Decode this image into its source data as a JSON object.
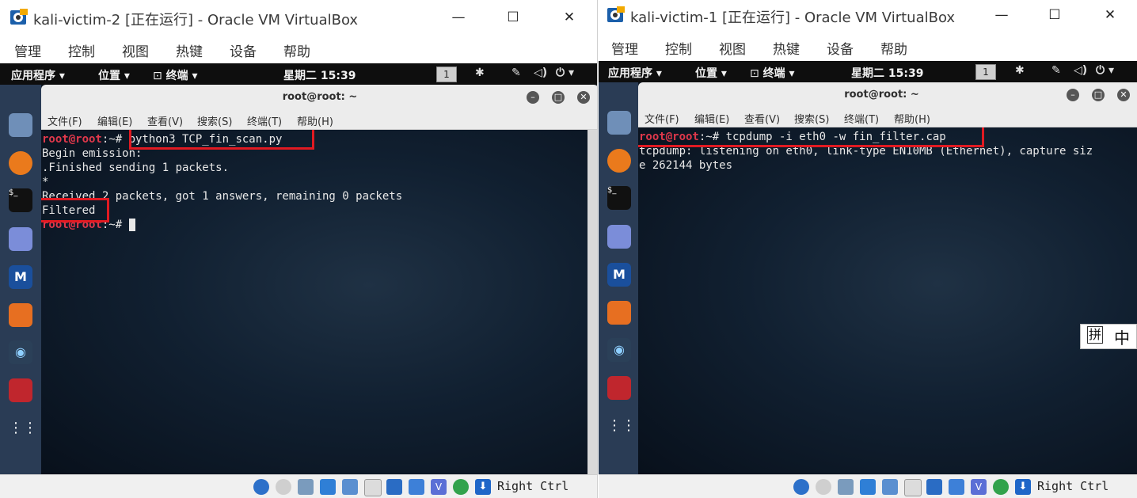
{
  "left_vm": {
    "window_title": "kali-victim-2 [正在运行] - Oracle VM VirtualBox",
    "menu": [
      "管理",
      "控制",
      "视图",
      "热键",
      "设备",
      "帮助"
    ],
    "topbar": {
      "apps": "应用程序",
      "places": "位置",
      "terminal": "终端",
      "clock": "星期二 15:39",
      "workspace": "1"
    },
    "terminal": {
      "title": "root@root: ~",
      "menu": [
        "文件(F)",
        "编辑(E)",
        "查看(V)",
        "搜索(S)",
        "终端(T)",
        "帮助(H)"
      ],
      "prompt_user": "root@root",
      "prompt_rest": ":~# ",
      "command": "python3 TCP_fin_scan.py",
      "output": [
        "Begin emission:",
        ".Finished sending 1 packets.",
        "*",
        "Received 2 packets, got 1 answers, remaining 0 packets",
        "Filtered"
      ]
    },
    "host_key": "Right Ctrl"
  },
  "right_vm": {
    "window_title": "kali-victim-1 [正在运行] - Oracle VM VirtualBox",
    "menu": [
      "管理",
      "控制",
      "视图",
      "热键",
      "设备",
      "帮助"
    ],
    "topbar": {
      "apps": "应用程序",
      "places": "位置",
      "terminal": "终端",
      "clock": "星期二 15:39",
      "workspace": "1"
    },
    "terminal": {
      "title": "root@root: ~",
      "menu": [
        "文件(F)",
        "编辑(E)",
        "查看(V)",
        "搜索(S)",
        "终端(T)",
        "帮助(H)"
      ],
      "prompt_user": "root@root",
      "prompt_rest": ":~# ",
      "command": "tcpdump -i eth0 -w fin_filter.cap",
      "output": [
        "tcpdump: listening on eth0, link-type EN10MB (Ethernet), capture siz",
        "e 262144 bytes"
      ]
    },
    "host_key": "Right Ctrl"
  },
  "ime": {
    "mode1": "拼",
    "mode2": "中"
  },
  "colors": {
    "highlight": "#e11a22",
    "prompt_user": "#e0384b",
    "prompt_path": "#4d8cf3"
  }
}
